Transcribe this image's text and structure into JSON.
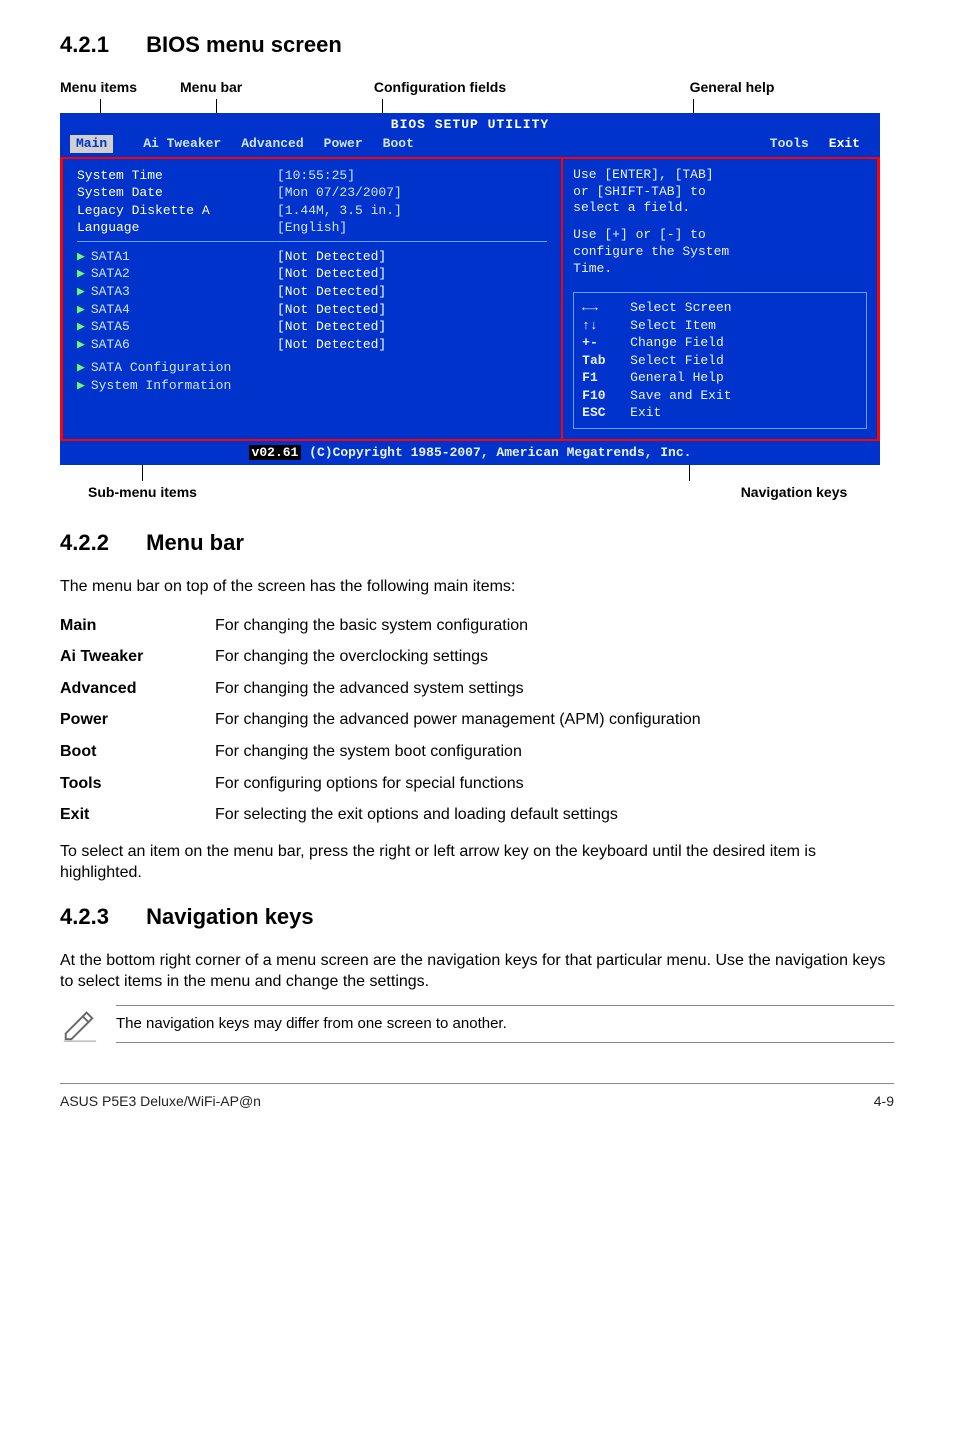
{
  "sections": {
    "s1": {
      "num": "4.2.1",
      "title": "BIOS menu screen"
    },
    "s2": {
      "num": "4.2.2",
      "title": "Menu bar"
    },
    "s3": {
      "num": "4.2.3",
      "title": "Navigation keys"
    }
  },
  "annot_top": {
    "a1": "Menu items",
    "a2": "Menu bar",
    "a3": "Configuration fields",
    "a4": "General help"
  },
  "bios": {
    "title": "BIOS SETUP UTILITY",
    "tabs": {
      "main": "Main",
      "ai": "Ai Tweaker",
      "adv": "Advanced",
      "power": "Power",
      "boot": "Boot",
      "tools": "Tools",
      "exit": "Exit"
    },
    "left": {
      "system_time_k": "System Time",
      "system_time_v": "[10:55:25]",
      "system_date_k": "System Date",
      "system_date_v": "[Mon 07/23/2007]",
      "legacy_k": "Legacy Diskette A",
      "legacy_v": "[1.44M, 3.5 in.]",
      "language_k": "Language",
      "language_v": "[English]",
      "sata": [
        {
          "name": "SATA1",
          "val": "[Not Detected]"
        },
        {
          "name": "SATA2",
          "val": "[Not Detected]"
        },
        {
          "name": "SATA3",
          "val": "[Not Detected]"
        },
        {
          "name": "SATA4",
          "val": "[Not Detected]"
        },
        {
          "name": "SATA5",
          "val": "[Not Detected]"
        },
        {
          "name": "SATA6",
          "val": "[Not Detected]"
        }
      ],
      "sata_cfg": "SATA Configuration",
      "sys_info": "System Information"
    },
    "right": {
      "help1": "Use [ENTER], [TAB]",
      "help2": "or [SHIFT-TAB] to",
      "help3": "select a field.",
      "help4": "Use [+] or [-] to",
      "help5": "configure the System",
      "help6": "Time.",
      "nav": [
        {
          "key": "←→",
          "desc": "Select Screen"
        },
        {
          "key": "↑↓",
          "desc": "Select Item"
        },
        {
          "key": "+-",
          "desc": "Change Field"
        },
        {
          "key": "Tab",
          "desc": "Select Field"
        },
        {
          "key": "F1",
          "desc": "General Help"
        },
        {
          "key": "F10",
          "desc": "Save and Exit"
        },
        {
          "key": "ESC",
          "desc": "Exit"
        }
      ]
    },
    "footer_ver": "v02.61",
    "footer_txt": " (C)Copyright 1985-2007, American Megatrends, Inc."
  },
  "annot_bottom": {
    "b1": "Sub-menu items",
    "b2": "Navigation keys"
  },
  "menubar_intro": "The menu bar on top of the screen has the following main items:",
  "defs": [
    {
      "term": "Main",
      "desc": "For changing the basic system configuration"
    },
    {
      "term": "Ai Tweaker",
      "desc": "For changing the overclocking settings"
    },
    {
      "term": "Advanced",
      "desc": "For changing the advanced system settings"
    },
    {
      "term": "Power",
      "desc": "For changing the advanced power management (APM) configuration"
    },
    {
      "term": "Boot",
      "desc": "For changing the system boot configuration"
    },
    {
      "term": "Tools",
      "desc": "For configuring options for special functions"
    },
    {
      "term": "Exit",
      "desc": "For selecting the exit options and loading default settings"
    }
  ],
  "menubar_outro": "To select an item on the menu bar, press the right or left arrow key on the keyboard until the desired item is highlighted.",
  "navkeys_body": "At the bottom right corner of a menu screen are the navigation keys for that particular menu. Use the navigation keys to select items in the menu and change the settings.",
  "note": "The navigation keys may differ from one screen to another.",
  "footer": {
    "left": "ASUS P5E3 Deluxe/WiFi-AP@n",
    "right": "4-9"
  }
}
